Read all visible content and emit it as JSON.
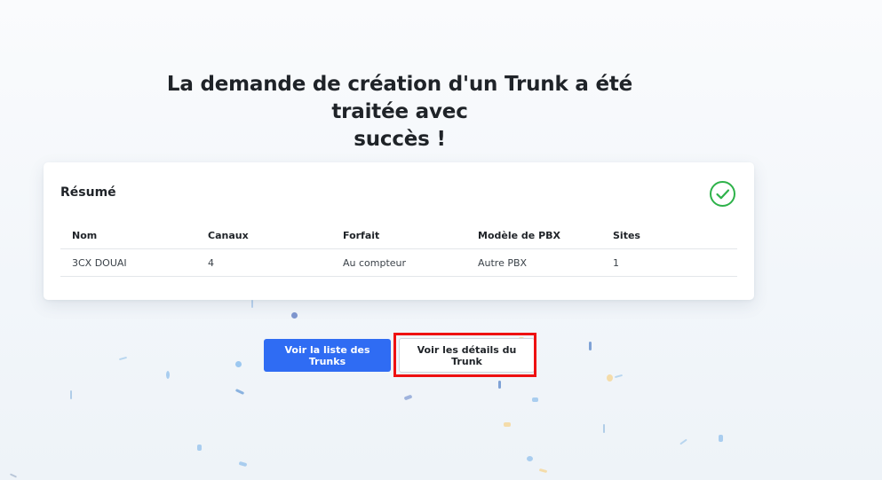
{
  "heading": {
    "line1": "La demande de création d'un Trunk a été traitée avec",
    "line2": "succès !"
  },
  "summary": {
    "title": "Résumé",
    "status_icon": "check-circle-icon",
    "status_color": "#2eb24a",
    "columns": [
      "Nom",
      "Canaux",
      "Forfait",
      "Modèle de PBX",
      "Sites"
    ],
    "rows": [
      [
        "3CX DOUAI",
        "4",
        "Au compteur",
        "Autre PBX",
        "1"
      ]
    ]
  },
  "actions": {
    "list_label": "Voir la liste des Trunks",
    "details_label": "Voir les détails du Trunk"
  },
  "colors": {
    "primary": "#2f6cf3",
    "highlight": "#ee1111"
  }
}
